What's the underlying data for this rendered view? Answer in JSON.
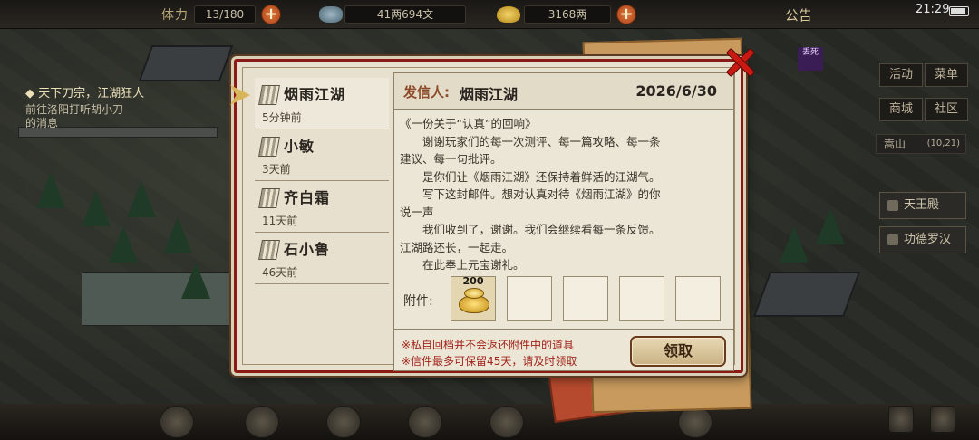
{
  "topbar": {
    "stamina_label": "体力",
    "stamina_value": "13/180",
    "copper_value": "41两694文",
    "silver_value": "3168两",
    "notice_label": "公告",
    "time": "21:29"
  },
  "quest": {
    "title": "◆ 天下刀宗，江湖狂人",
    "desc_line1": "前往洛阳打听胡小刀",
    "desc_line2": "的消息"
  },
  "right_menu": {
    "activity": "活动",
    "menu": "菜单",
    "shop": "商城",
    "community": "社区",
    "location": "嵩山",
    "coords": "(10,21)",
    "list": [
      "天王殿",
      "功德罗汉"
    ]
  },
  "seal_text": "丢死",
  "mail": {
    "senders": [
      {
        "name": "烟雨江湖",
        "time": "5分钟前"
      },
      {
        "name": "小敏",
        "time": "3天前"
      },
      {
        "name": "齐白霜",
        "time": "11天前"
      },
      {
        "name": "石小鲁",
        "time": "46天前"
      }
    ],
    "from_label": "发信人:",
    "from_name": "烟雨江湖",
    "date": "2026/6/30",
    "body": [
      "《一份关于“认真”的回响》",
      "　　谢谢玩家们的每一次测评、每一篇攻略、每一条",
      "建议、每一句批评。",
      "　　是你们让《烟雨江湖》还保持着鲜活的江湖气。",
      "　　写下这封邮件。想对认真对待《烟雨江湖》的你",
      "说一声",
      "　　我们收到了，谢谢。我们会继续看每一条反馈。",
      "江湖路还长，一起走。",
      "　　在此奉上元宝谢礼。"
    ],
    "attach_label": "附件:",
    "attachment_qty": "200",
    "attachment_icon": "gold-ingot-icon",
    "note1": "※私自回档并不会返还附件中的道具",
    "note2": "※信件最多可保留45天，请及时领取",
    "claim_label": "领取"
  },
  "colors": {
    "modal_border": "#8c1a14",
    "note_red": "#a1221a",
    "close_red": "#c81a12"
  }
}
